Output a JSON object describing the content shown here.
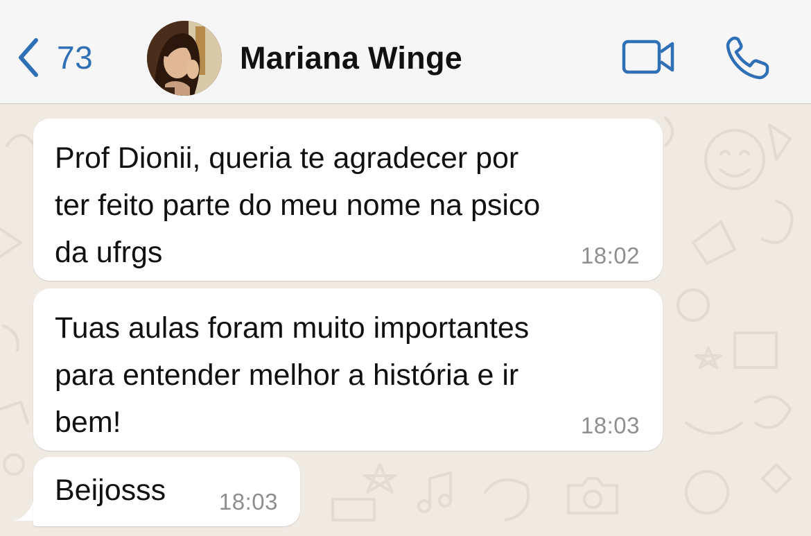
{
  "header": {
    "back_count": "73",
    "contact_name": "Mariana Winge",
    "accent_color": "#2f6fb6",
    "icons": [
      "chevron-left-icon",
      "video-camera-icon",
      "phone-icon"
    ]
  },
  "messages": [
    {
      "lines": [
        "Prof Dionii, queria te agradecer por",
        "ter feito parte do meu nome na psico",
        "da ufrgs"
      ],
      "time": "18:02"
    },
    {
      "lines": [
        "Tuas aulas foram muito importantes",
        "para entender melhor a história e ir",
        "bem!"
      ],
      "time": "18:03"
    },
    {
      "lines": [
        "Beijosss"
      ],
      "time": "18:03"
    }
  ],
  "colors": {
    "chat_background": "#efeae2",
    "bubble_incoming": "#ffffff",
    "header_background": "#f6f6f6",
    "timestamp": "#8e8e8e"
  }
}
